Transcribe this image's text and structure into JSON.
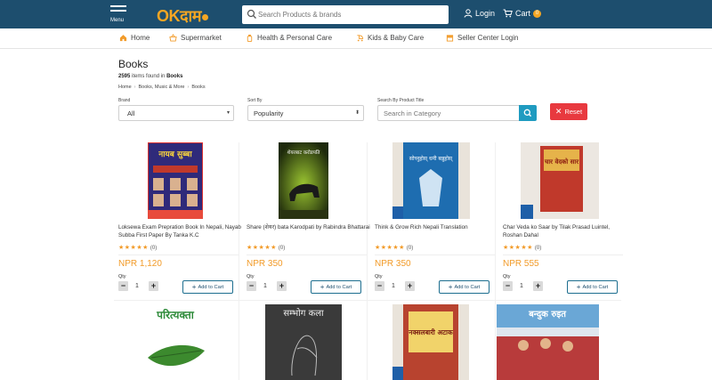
{
  "header": {
    "menu_label": "Menu",
    "logo_ok": "OK",
    "logo_dam": "दाम",
    "search_placeholder": "Search Products & brands",
    "login": "Login",
    "cart": "Cart",
    "cart_count": "0"
  },
  "nav": [
    {
      "label": "Home",
      "icon": "home-icon"
    },
    {
      "label": "Supermarket",
      "icon": "basket-icon"
    },
    {
      "label": "Health & Personal Care",
      "icon": "health-icon"
    },
    {
      "label": "Kids & Baby Care",
      "icon": "stroller-icon"
    },
    {
      "label": "Seller Center Login",
      "icon": "store-icon"
    }
  ],
  "page": {
    "title": "Books",
    "count_number": "2595",
    "count_text": "items found in",
    "count_category": "Books",
    "breadcrumb": [
      "Home",
      "Books, Music & More",
      "Books"
    ]
  },
  "filters": {
    "brand_label": "Brand",
    "brand_value": "All",
    "sort_label": "Sort By",
    "sort_value": "Popularity",
    "title_label": "Search By Product Title",
    "title_placeholder": "Search in Category",
    "reset": "Reset"
  },
  "products": [
    {
      "title": "Loksewa Exam Prepration Book In Nepali, Nayab Subba First Paper By Tanka K.C",
      "rating": "(0)",
      "price": "NPR 1,120",
      "qty_label": "Qty",
      "qty": "1",
      "add": "Add to Cart",
      "cover_text": "नायब सुब्बा"
    },
    {
      "title": "Share (शेयर) bata Karodpati by Rabindra Bhattarai",
      "rating": "(0)",
      "price": "NPR 350",
      "qty_label": "Qty",
      "qty": "1",
      "add": "Add to Cart",
      "cover_text": "शेयरबाट करोडपति"
    },
    {
      "title": "Think & Grow Rich Nepali Translation",
      "rating": "(0)",
      "price": "NPR 350",
      "qty_label": "Qty",
      "qty": "1",
      "add": "Add to Cart",
      "cover_text": "सोच्नुहोस् धनी बन्नुहोस्"
    },
    {
      "title": "Char Veda ko Saar by Tilak Prasad Luintel, Roshan Dahal",
      "rating": "(0)",
      "price": "NPR 555",
      "qty_label": "Qty",
      "qty": "1",
      "add": "Add to Cart",
      "cover_text": "चार वेदको सार"
    },
    {
      "cover_text": "परित्यक्ता"
    },
    {
      "cover_text": "सम्भोग कला"
    },
    {
      "cover_text": "नक्सलबारी अटाक"
    },
    {
      "cover_text": "बन्दुक रुइत"
    }
  ],
  "colors": {
    "header_bg": "#1d4e6e",
    "accent": "#f29b29",
    "reset": "#e8393f",
    "search_btn": "#1f9bc0"
  }
}
